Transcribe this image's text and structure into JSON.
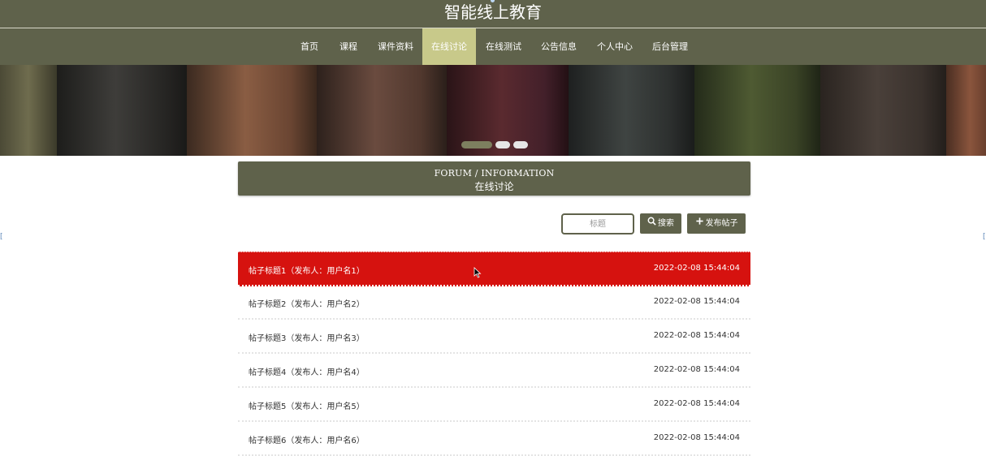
{
  "header": {
    "title": "智能线上教育"
  },
  "nav": {
    "items": [
      {
        "label": "首页"
      },
      {
        "label": "课程"
      },
      {
        "label": "课件资料"
      },
      {
        "label": "在线讨论"
      },
      {
        "label": "在线测试"
      },
      {
        "label": "公告信息"
      },
      {
        "label": "个人中心"
      },
      {
        "label": "后台管理"
      }
    ],
    "active_index": 3
  },
  "banner": {
    "slide_count": 3,
    "active_slide": 1
  },
  "section": {
    "title_en": "FORUM / INFORMATION",
    "title_cn": "在线讨论"
  },
  "toolbar": {
    "search_placeholder": "标题",
    "search_label": "搜索",
    "publish_label": "发布帖子"
  },
  "posts": [
    {
      "title": "帖子标题1（发布人：用户名1）",
      "date": "2022-02-08 15:44:04"
    },
    {
      "title": "帖子标题2（发布人：用户名2）",
      "date": "2022-02-08 15:44:04"
    },
    {
      "title": "帖子标题3（发布人：用户名3）",
      "date": "2022-02-08 15:44:04"
    },
    {
      "title": "帖子标题4（发布人：用户名4）",
      "date": "2022-02-08 15:44:04"
    },
    {
      "title": "帖子标题5（发布人：用户名5）",
      "date": "2022-02-08 15:44:04"
    },
    {
      "title": "帖子标题6（发布人：用户名6）",
      "date": "2022-02-08 15:44:04"
    }
  ],
  "colors": {
    "theme": "#5f624b",
    "nav_active": "#c8c98a",
    "highlight_row": "#d6120f"
  },
  "icons": {
    "search": "magnifier-icon",
    "publish": "plus-icon"
  }
}
